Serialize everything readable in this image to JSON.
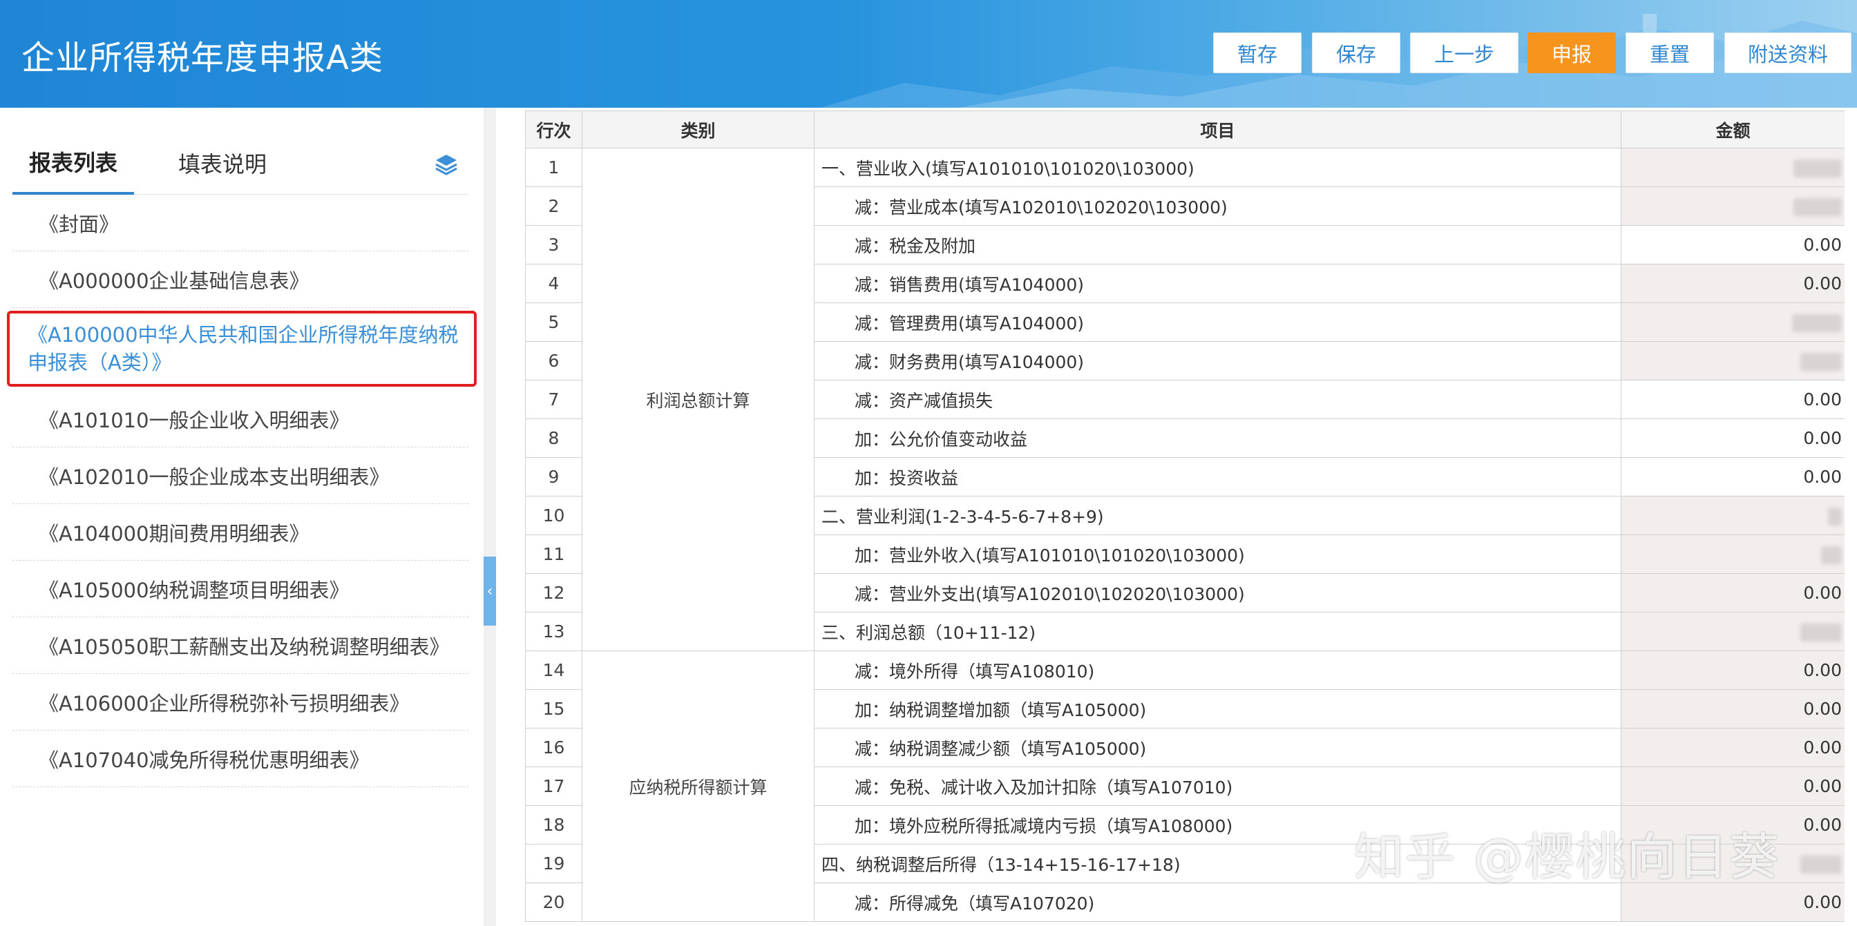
{
  "header": {
    "title": "企业所得税年度申报A类",
    "buttons": [
      "暂存",
      "保存",
      "上一步",
      "申报",
      "重置",
      "附送资料"
    ]
  },
  "sidebar": {
    "tabs": [
      "报表列表",
      "填表说明"
    ],
    "items": [
      "《封面》",
      "《A000000企业基础信息表》",
      "《A100000中华人民共和国企业所得税年度纳税申报表（A类）》",
      "《A101010一般企业收入明细表》",
      "《A102010一般企业成本支出明细表》",
      "《A104000期间费用明细表》",
      "《A105000纳税调整项目明细表》",
      "《A105050职工薪酬支出及纳税调整明细表》",
      "《A106000企业所得税弥补亏损明细表》",
      "《A107040减免所得税优惠明细表》"
    ],
    "active_index": 2
  },
  "table": {
    "headers": [
      "行次",
      "类别",
      "项目",
      "金额"
    ],
    "categories": [
      "利润总额计算",
      "应纳税所得额计算"
    ],
    "rows": [
      {
        "no": "1",
        "item": "一、营业收入(填写A101010\\101020\\103000)",
        "amount": "",
        "shade": "gray"
      },
      {
        "no": "2",
        "item": "减：营业成本(填写A102010\\102020\\103000)",
        "amount": "",
        "shade": "gray"
      },
      {
        "no": "3",
        "item": "减：税金及附加",
        "amount": "0.00",
        "shade": "white"
      },
      {
        "no": "4",
        "item": "减：销售费用(填写A104000)",
        "amount": "0.00",
        "shade": "gray"
      },
      {
        "no": "5",
        "item": "减：管理费用(填写A104000)",
        "amount": "",
        "shade": "gray"
      },
      {
        "no": "6",
        "item": "减：财务费用(填写A104000)",
        "amount": "",
        "shade": "gray"
      },
      {
        "no": "7",
        "item": "减：资产减值损失",
        "amount": "0.00",
        "shade": "white"
      },
      {
        "no": "8",
        "item": "加：公允价值变动收益",
        "amount": "0.00",
        "shade": "white"
      },
      {
        "no": "9",
        "item": "加：投资收益",
        "amount": "0.00",
        "shade": "white"
      },
      {
        "no": "10",
        "item": "二、营业利润(1-2-3-4-5-6-7+8+9)",
        "amount": "",
        "shade": "gray"
      },
      {
        "no": "11",
        "item": "加：营业外收入(填写A101010\\101020\\103000)",
        "amount": "",
        "shade": "gray"
      },
      {
        "no": "12",
        "item": "减：营业外支出(填写A102010\\102020\\103000)",
        "amount": "0.00",
        "shade": "gray"
      },
      {
        "no": "13",
        "item": "三、利润总额（10+11-12)",
        "amount": "",
        "shade": "gray"
      },
      {
        "no": "14",
        "item": "减：境外所得（填写A108010)",
        "amount": "0.00",
        "shade": "gray"
      },
      {
        "no": "15",
        "item": "加：纳税调整增加额（填写A105000)",
        "amount": "0.00",
        "shade": "gray"
      },
      {
        "no": "16",
        "item": "减：纳税调整减少额（填写A105000)",
        "amount": "0.00",
        "shade": "gray"
      },
      {
        "no": "17",
        "item": "减：免税、减计收入及加计扣除（填写A107010)",
        "amount": "0.00",
        "shade": "gray"
      },
      {
        "no": "18",
        "item": "加：境外应税所得抵减境内亏损（填写A108000)",
        "amount": "0.00",
        "shade": "gray"
      },
      {
        "no": "19",
        "item": "四、纳税调整后所得（13-14+15-16-17+18)",
        "amount": "",
        "shade": "gray"
      },
      {
        "no": "20",
        "item": "减：所得减免（填写A107020)",
        "amount": "0.00",
        "shade": "gray"
      }
    ]
  },
  "watermark": "知乎 @樱桃向日葵",
  "colors": {
    "header": "#2793de",
    "primary_button": "#f7941d",
    "active_border": "#e02020",
    "link": "#3a8fd6"
  }
}
